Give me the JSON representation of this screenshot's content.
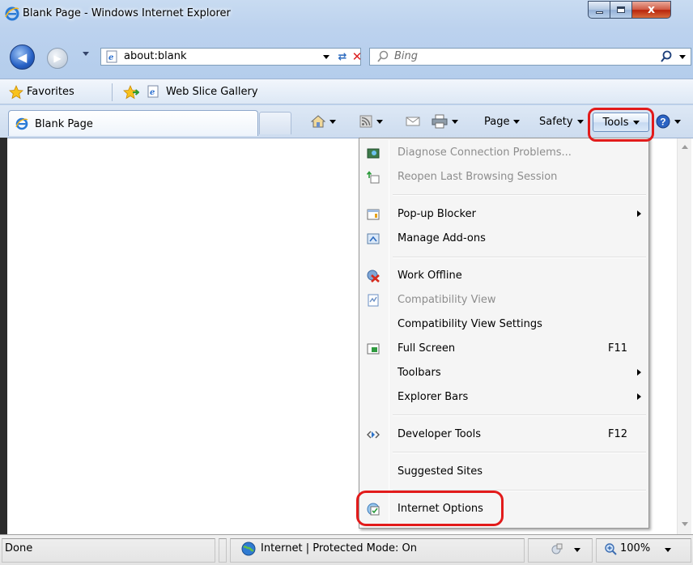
{
  "window": {
    "title": "Blank Page - Windows Internet Explorer",
    "close_glyph": "x"
  },
  "navigation": {
    "address": "about:blank",
    "search_placeholder": "Bing"
  },
  "favorites_bar": {
    "favorites_label": "Favorites",
    "items": [
      "Web Slice Gallery"
    ]
  },
  "tabs": [
    {
      "label": "Blank Page",
      "active": true
    }
  ],
  "command_bar": {
    "page_label": "Page",
    "safety_label": "Safety",
    "tools_label": "Tools",
    "icons": [
      "home-icon",
      "feeds-icon",
      "read-mail-icon",
      "print-icon",
      "help-icon"
    ]
  },
  "tools_menu": {
    "items": [
      {
        "label": "Diagnose Connection Problems...",
        "enabled": false,
        "icon": "diagnose-icon"
      },
      {
        "label": "Reopen Last Browsing Session",
        "enabled": false,
        "icon": "reopen-session-icon"
      },
      {
        "label": "Pop-up Blocker",
        "enabled": true,
        "icon": "popup-blocker-icon",
        "submenu": true
      },
      {
        "label": "Manage Add-ons",
        "enabled": true,
        "icon": "manage-addons-icon"
      },
      {
        "label": "Work Offline",
        "enabled": true,
        "icon": "work-offline-icon"
      },
      {
        "label": "Compatibility View",
        "enabled": false,
        "icon": "compatibility-view-icon"
      },
      {
        "label": "Compatibility View Settings",
        "enabled": true
      },
      {
        "label": "Full Screen",
        "enabled": true,
        "icon": "full-screen-icon",
        "shortcut": "F11"
      },
      {
        "label": "Toolbars",
        "enabled": true,
        "submenu": true
      },
      {
        "label": "Explorer Bars",
        "enabled": true,
        "submenu": true
      },
      {
        "label": "Developer Tools",
        "enabled": true,
        "icon": "developer-tools-icon",
        "shortcut": "F12"
      },
      {
        "label": "Suggested Sites",
        "enabled": true
      },
      {
        "label": "Internet Options",
        "enabled": true,
        "icon": "internet-options-icon"
      }
    ]
  },
  "status_bar": {
    "status": "Done",
    "zone": "Internet | Protected Mode: On",
    "zoom": "100%"
  },
  "highlight_color": "#e21b1b"
}
